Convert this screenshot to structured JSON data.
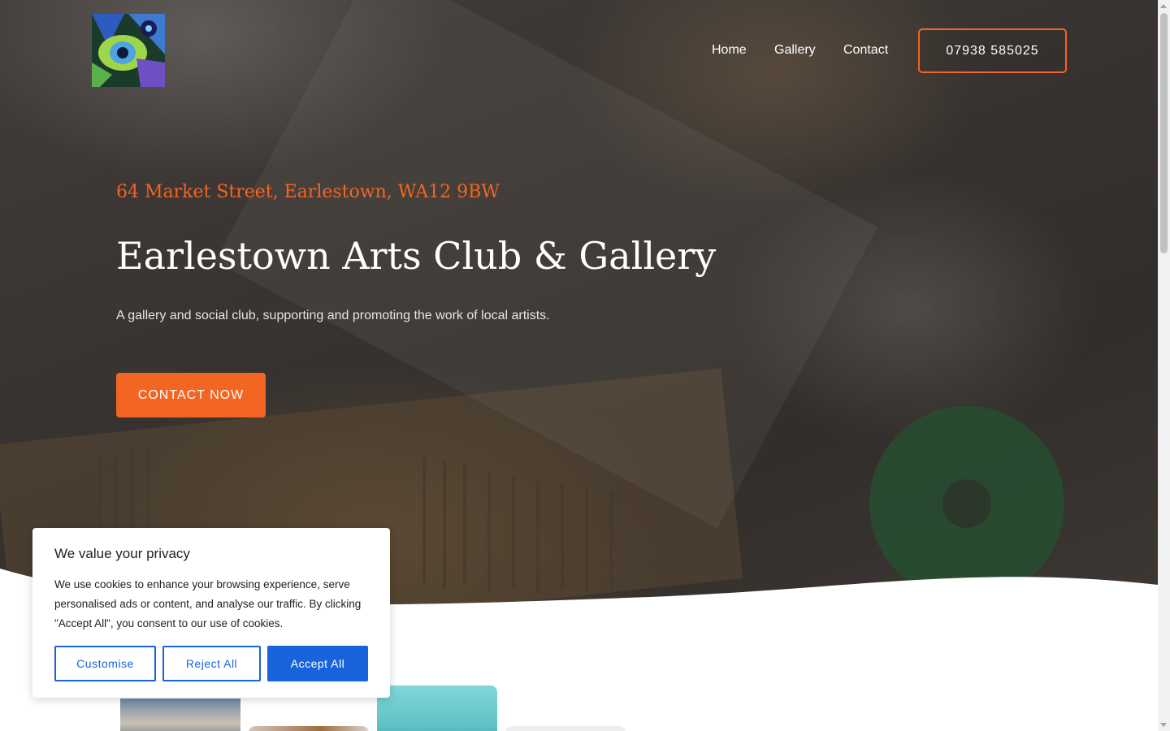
{
  "header": {
    "logo_alt": "Earlestown Arts Club logo",
    "nav": [
      {
        "label": "Home"
      },
      {
        "label": "Gallery"
      },
      {
        "label": "Contact"
      }
    ],
    "phone": "07938 585025"
  },
  "hero": {
    "address": "64 Market Street, Earlestown, WA12 9BW",
    "title": "Earlestown Arts Club & Gallery",
    "subtitle": "A gallery and social club, supporting and promoting the work of local artists.",
    "cta_label": "CONTACT NOW"
  },
  "cookie_banner": {
    "title": "We value your privacy",
    "text": "We use cookies to enhance your browsing experience, serve personalised ads or content, and analyse our traffic. By clicking \"Accept All\", you consent to our use of cookies.",
    "customise_label": "Customise",
    "reject_label": "Reject All",
    "accept_label": "Accept All"
  },
  "colors": {
    "accent": "#f26522",
    "cookie_blue": "#1863dc",
    "hero_text": "#ffffff"
  },
  "icons": {
    "scroll_up": "chevron-up-icon",
    "scroll_down": "chevron-down-icon"
  }
}
